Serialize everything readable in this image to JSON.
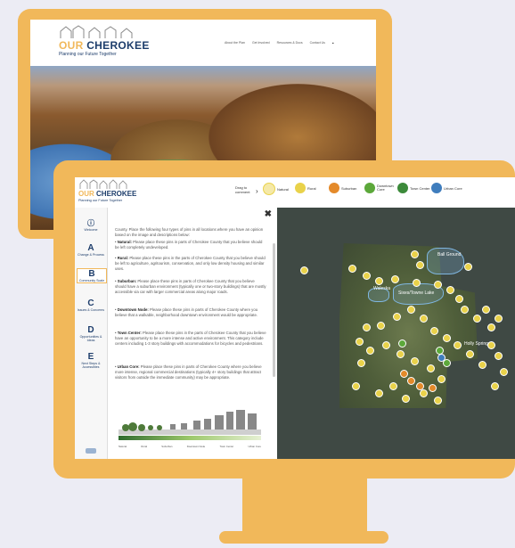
{
  "back_screen": {
    "logo": {
      "line1": "OUR CHEROKEE",
      "line2": "Planning our Future Together"
    },
    "nav_items": [
      "About the Plan",
      "Get Involved",
      "Resources & Docs",
      "Contact Us"
    ]
  },
  "front_screen": {
    "logo": {
      "line1": "OUR CHEROKEE",
      "line2": "Planning our Future Together"
    },
    "drag_prompt": "Drag to comment",
    "pin_categories": [
      {
        "label": "Natural",
        "color": "#e9d24a"
      },
      {
        "label": "Rural",
        "color": "#e9d24a"
      },
      {
        "label": "Suburban",
        "color": "#e48a2a"
      },
      {
        "label": "Downtown Core",
        "color": "#5ca83a"
      },
      {
        "label": "Town Center",
        "color": "#3c8a3a"
      },
      {
        "label": "Urban Core",
        "color": "#3f7dbd"
      }
    ],
    "nav": [
      {
        "big": "i",
        "small": "Welcome"
      },
      {
        "big": "A",
        "small": "Change & Process"
      },
      {
        "big": "B",
        "small": "Community Scale"
      },
      {
        "big": "C",
        "small": "Issues & Concerns"
      },
      {
        "big": "D",
        "small": "Opportunities & Ideas"
      },
      {
        "big": "E",
        "small": "Next Steps & Accessibles"
      }
    ],
    "panel": {
      "intro": "County. Place the following four types of pins in all locations where you have an opinion based on the image and descriptions below:",
      "bullets": [
        {
          "term": "Natural:",
          "text": "Please place these pins in parts of Cherokee County that you believe should be left completely undeveloped."
        },
        {
          "term": "Rural:",
          "text": "Please place these pins in the parts of Cherokee County that you believe should be left to agriculture, agritourism, conservation, and only low density housing and similar uses."
        },
        {
          "term": "Suburban:",
          "text": "Please place these pins in parts of Cherokee County that you believe should have a suburban environment (typically one or two-story buildings) that are mostly accessible via car with larger commercial areas along major roads."
        },
        {
          "term": "Downtown Node:",
          "text": "Please place these pins in parts of Cherokee County where you believe that a walkable, neighborhood downtown environment would be appropriate."
        },
        {
          "term": "Town Center:",
          "text": "Please place these pins in the parts of Cherokee County that you believe have an opportunity to be a more intense and active environment. This category include centers including 1-3 story buildings with accommodations for bicycles and pedestrians."
        },
        {
          "term": "Urban Core:",
          "text": "Please place these pins in parts of Cherokee County where you believe more intense, regional commercial destinations (typically 4+ story buildings that attract visitors from outside the immediate community) may be appropriate."
        }
      ],
      "transect_labels": [
        "Natural",
        "Rural",
        "Suburban",
        "Downtown Node",
        "Town Center",
        "Urban Core"
      ]
    },
    "map": {
      "labels": [
        "Ball Ground",
        "Waleska",
        "Sixes/Towne Lake",
        "Holly Springs"
      ]
    }
  }
}
